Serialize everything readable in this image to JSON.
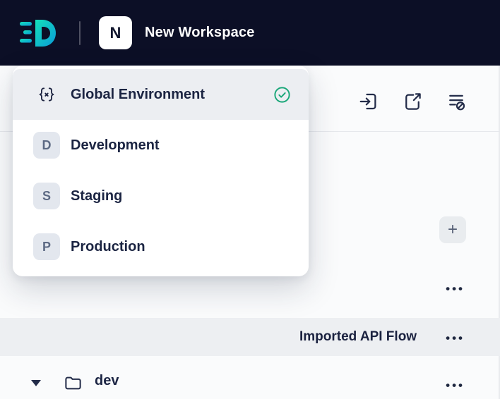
{
  "header": {
    "workspace_initial": "N",
    "workspace_name": "New Workspace"
  },
  "env_bar": {
    "selected_label": "Global Environment",
    "state": "expanded",
    "actions": [
      {
        "name": "import"
      },
      {
        "name": "export"
      },
      {
        "name": "environment-quick-look"
      }
    ]
  },
  "dropdown": {
    "items": [
      {
        "label": "Global Environment",
        "icon": "braces-variable",
        "selected": true
      },
      {
        "label": "Development",
        "initial": "D",
        "selected": false
      },
      {
        "label": "Staging",
        "initial": "S",
        "selected": false
      },
      {
        "label": "Production",
        "initial": "P",
        "selected": false
      }
    ]
  },
  "sidebar": {
    "add_button": "+",
    "overflow": "•••",
    "rows": [
      {
        "label": "Imported API Flow",
        "highlighted": true
      },
      {
        "label": "dev",
        "type": "folder",
        "expanded": true
      }
    ]
  },
  "colors": {
    "header_bg": "#0c0f26",
    "logo_teal": "#12d9b5",
    "logo_blue": "#0a9bd8",
    "text_dark": "#1c2340",
    "pill_bg": "#e8ebf0",
    "selected_row_bg": "#eceef2",
    "badge_bg": "#e3e7ee",
    "check_green": "#18a678"
  }
}
